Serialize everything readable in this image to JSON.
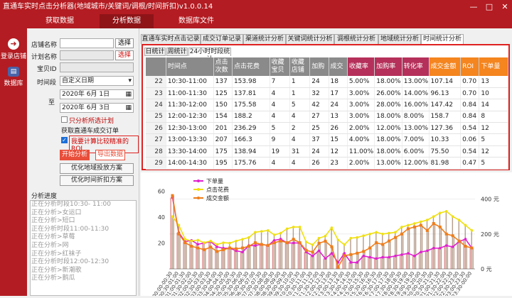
{
  "app": {
    "title": "直通车实时点击分析器(地域城市/关键词/调根/时间折扣)v1.0.0.14",
    "min": "—",
    "max": "□",
    "close": "✕"
  },
  "menu": [
    "获取数据",
    "分析数据",
    "数据库文件"
  ],
  "leftnav": [
    {
      "label": "登录店铺",
      "icon": "arrow-right-icon",
      "glyph": "➜"
    },
    {
      "label": "数据库",
      "icon": "database-icon",
      "glyph": "▤"
    }
  ],
  "form": {
    "shop_label": "店铺名称",
    "plan_label": "计划名称",
    "item_label": "宝贝ID",
    "period_label": "时间段",
    "to_label": "至",
    "select_label": "选择",
    "period_value": "自定义日期",
    "date_from": "2020年 6月 1日",
    "date_to": "2020年 6月 3日",
    "only_plan": "只分析所选计划",
    "fetch_label": "获取直通车成交订单",
    "roi_label": "我要计算比较精准的ROI",
    "start_btn": "开始分析",
    "export_btn": "导出数据",
    "opt_region_btn": "优化地域投放方案",
    "opt_time_btn": "优化时间折扣方案"
  },
  "progress": {
    "title": "分析进度",
    "lines": [
      "正在分析时段10:30- 11:00",
      "正在分析>女运口",
      "正在分析>短口",
      "正在分析时段11:00-11:30",
      "正在分析>草莓",
      "正在分析>网",
      "正在分析>红袜子",
      "正在分析时段12:00-12:30",
      "正在分析>新潮歌",
      "正在分析>鹅瓜"
    ]
  },
  "tabs": [
    "直通车实时点击记录",
    "成交订单记录",
    "渠道统计分析",
    "关键词统计分析",
    "调根统计分析",
    "地域统计分析",
    "时间统计分析"
  ],
  "subtabs": [
    "日统计",
    "周统计",
    "24小时时段统计"
  ],
  "table": {
    "headers": [
      "",
      "时间点",
      "点击次数",
      "点击花费",
      "收藏宝贝",
      "收藏店铺",
      "加购",
      "成交",
      "收藏率",
      "加购率",
      "转化率",
      "成交金额",
      "ROI",
      "下单量"
    ],
    "rows": [
      [
        "22",
        "10:30-11:00",
        "137",
        "153.98",
        "7",
        "1",
        "24",
        "18",
        "5.00%",
        "18.00%",
        "13.00%",
        "107.14",
        "0.70",
        "13"
      ],
      [
        "23",
        "11:00-11:30",
        "125",
        "137.81",
        "4",
        "1",
        "32",
        "17",
        "3.00%",
        "26.00%",
        "14.00%",
        "96.13",
        "0.70",
        "10"
      ],
      [
        "24",
        "11:30-12:00",
        "150",
        "175.58",
        "4",
        "5",
        "42",
        "24",
        "3.00%",
        "28.00%",
        "16.00%",
        "147.42",
        "0.84",
        "14"
      ],
      [
        "25",
        "12:00-12:30",
        "154",
        "188.2",
        "4",
        "4",
        "27",
        "13",
        "3.00%",
        "18.00%",
        "8.00%",
        "158.7",
        "0.84",
        "8"
      ],
      [
        "26",
        "12:30-13:00",
        "201",
        "236.29",
        "5",
        "2",
        "25",
        "26",
        "2.00%",
        "12.00%",
        "13.00%",
        "127.36",
        "0.54",
        "12"
      ],
      [
        "27",
        "13:00-13:30",
        "207",
        "166.3",
        "9",
        "4",
        "37",
        "15",
        "4.00%",
        "18.00%",
        "7.00%",
        "10.33",
        "0.06",
        "5"
      ],
      [
        "28",
        "13:30-14:00",
        "175",
        "138.94",
        "19",
        "31",
        "24",
        "12",
        "11.00%",
        "18.00%",
        "6.00%",
        "75.50",
        "0.54",
        "12"
      ],
      [
        "29",
        "14:00-14:30",
        "195",
        "175.76",
        "4",
        "4",
        "26",
        "23",
        "2.00%",
        "13.00%",
        "12.00%",
        "81.98",
        "0.47",
        "5"
      ]
    ]
  },
  "colors": {
    "brand": "#b31c22",
    "header_gray": "#8a8a8a",
    "header_pink": "#b5305a",
    "header_orange": "#f4851f",
    "highlight": "#e02020"
  },
  "chart_data": {
    "type": "line",
    "x": [
      "00:00-00:30",
      "00:30-01:00",
      "01:00-01:30",
      "01:30-02:00",
      "02:00-02:30",
      "02:30-03:00",
      "03:00-03:30",
      "03:30-04:00",
      "04:00-04:30",
      "04:30-05:00",
      "05:00-05:30",
      "05:30-06:00",
      "06:00-06:30",
      "06:30-07:00",
      "07:00-07:30",
      "07:30-08:00",
      "08:00-08:30",
      "08:30-09:00",
      "09:00-09:30",
      "09:30-10:00",
      "10:00-10:30",
      "10:30-11:00",
      "11:00-11:30",
      "11:30-12:00",
      "12:00-12:30",
      "12:30-13:00",
      "13:00-13:30",
      "13:30-14:00",
      "14:00-14:30",
      "14:30-15:00",
      "15:00-15:30",
      "15:30-16:00",
      "16:00-16:30",
      "16:30-17:00",
      "17:00-17:30",
      "17:30-18:00",
      "18:00-18:30",
      "18:30-19:00",
      "19:00-19:30",
      "19:30-20:00",
      "20:00-20:30",
      "20:30-21:00",
      "21:00-21:30",
      "21:30-22:00",
      "22:00-22:30",
      "22:30-23:00",
      "23:00-23:30",
      "23:30-00:00"
    ],
    "xlabels": [
      "00:00-00:30",
      "00:30-01:00",
      "01:00-01:30",
      "01:30-02:00",
      "02:00-02:30",
      "02:30-03:00",
      "03:00-03:30",
      "03:30-04:00",
      "04:00-04:30",
      "04:30-05:00",
      "05:00-05:30",
      "05:30-06:00",
      "06:00-06:30",
      "06:30-07:00",
      "07:00-07:30",
      "07:30-08:00",
      "08:00-08:30",
      "08:30-09:00",
      "09:00-09:30",
      "09:30-10:00",
      "10:00-10:30",
      "10:30-11:00",
      "11:00-11:30",
      "11:30-12:00",
      "12:00-12:30",
      "12:30-13:00",
      "13:00-13:30",
      "13:30-14:00",
      "14:00-14:30",
      "14:30-15:00",
      "15:00-15:30",
      "15:30-16:00",
      "16:00-16:30",
      "16:30-17:00",
      "17:00-17:30",
      "17:30-18:00",
      "18:00-18:30",
      "18:30-19:00",
      "19:00-19:30",
      "19:30-20:00",
      "20:00-20:30",
      "20:30-21:00",
      "21:00-21:30",
      "21:30-22:00",
      "22:00-22:30",
      "22:30-23:00",
      "23:00-23:30",
      "23:30-00:00"
    ],
    "yleft": {
      "ticks": [
        "20",
        "40",
        "60"
      ],
      "range": [
        0,
        70
      ]
    },
    "yright": {
      "ticks": [
        "0 元",
        "200 元",
        "400 元"
      ],
      "range": [
        0,
        520
      ]
    },
    "series": [
      {
        "name": "下单量",
        "color": "#e020d0",
        "axis": "left",
        "values": [
          55,
          28,
          21,
          22,
          19,
          20,
          21,
          17,
          16,
          16,
          14,
          13,
          18,
          18,
          19,
          18,
          22,
          23,
          20,
          20,
          20,
          13,
          10,
          14,
          8,
          12,
          5,
          12,
          5,
          5,
          10,
          9,
          8,
          9,
          9,
          10,
          11,
          12,
          10,
          13,
          14,
          16,
          16,
          18,
          17,
          21,
          23,
          16
        ]
      },
      {
        "name": "点击花费",
        "color": "#f0e010",
        "axis": "right",
        "values": [
          300,
          250,
          170,
          160,
          165,
          150,
          160,
          140,
          150,
          148,
          160,
          170,
          180,
          210,
          215,
          220,
          195,
          205,
          230,
          240,
          240,
          154,
          138,
          176,
          188,
          236,
          166,
          139,
          176,
          180,
          190,
          200,
          210,
          200,
          205,
          210,
          240,
          250,
          260,
          270,
          280,
          300,
          320,
          330,
          300,
          280,
          250,
          220
        ]
      },
      {
        "name": "成交金额",
        "color": "#f07e1a",
        "axis": "right",
        "values": [
          420,
          200,
          150,
          130,
          120,
          110,
          125,
          100,
          110,
          120,
          115,
          120,
          130,
          150,
          140,
          135,
          150,
          160,
          150,
          170,
          150,
          107,
          96,
          147,
          159,
          127,
          10,
          76,
          82,
          90,
          100,
          120,
          150,
          140,
          160,
          180,
          200,
          230,
          240,
          250,
          220,
          260,
          240,
          200,
          190,
          160,
          130,
          120
        ]
      }
    ],
    "legend_position": "top-left"
  }
}
